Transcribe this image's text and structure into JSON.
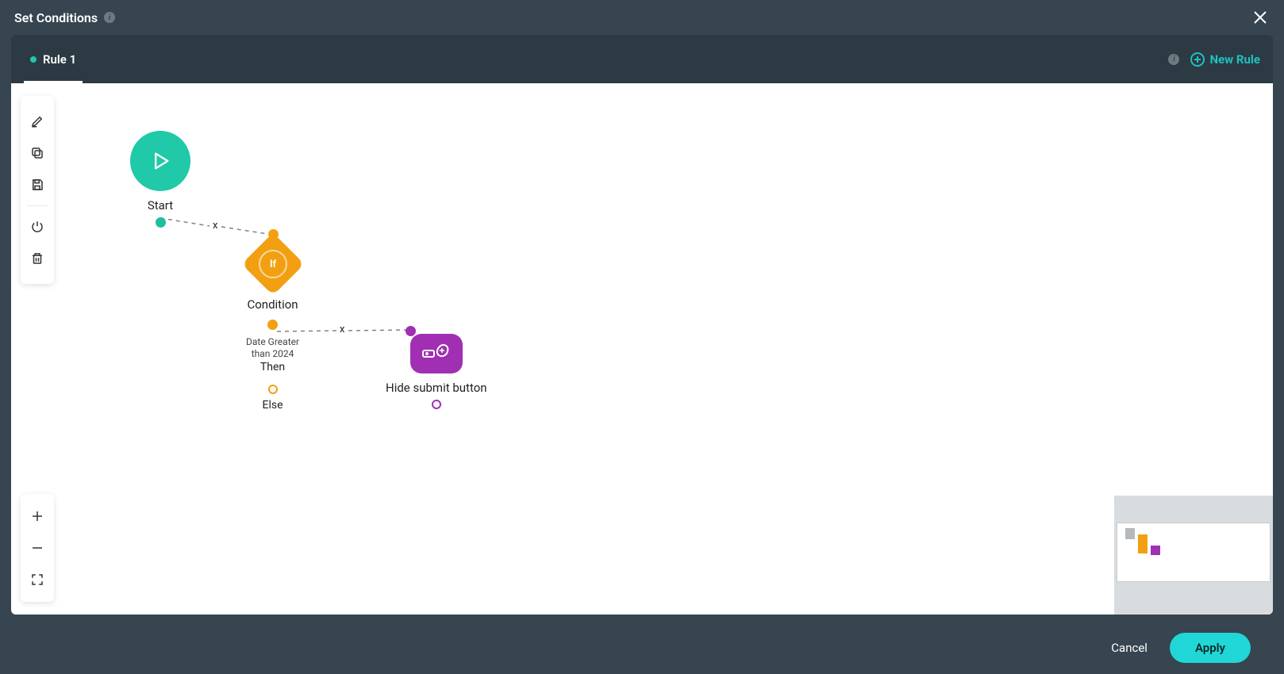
{
  "header": {
    "title": "Set Conditions"
  },
  "tabs": {
    "active": "Rule 1",
    "newRuleLabel": "New Rule"
  },
  "flow": {
    "start": {
      "label": "Start"
    },
    "condition": {
      "label": "Condition",
      "subtext1": "Date Greater",
      "subtext2": "than 2024",
      "thenLabel": "Then",
      "elseLabel": "Else",
      "badgeText": "If"
    },
    "action": {
      "label": "Hide submit button"
    }
  },
  "footer": {
    "cancel": "Cancel",
    "apply": "Apply"
  }
}
